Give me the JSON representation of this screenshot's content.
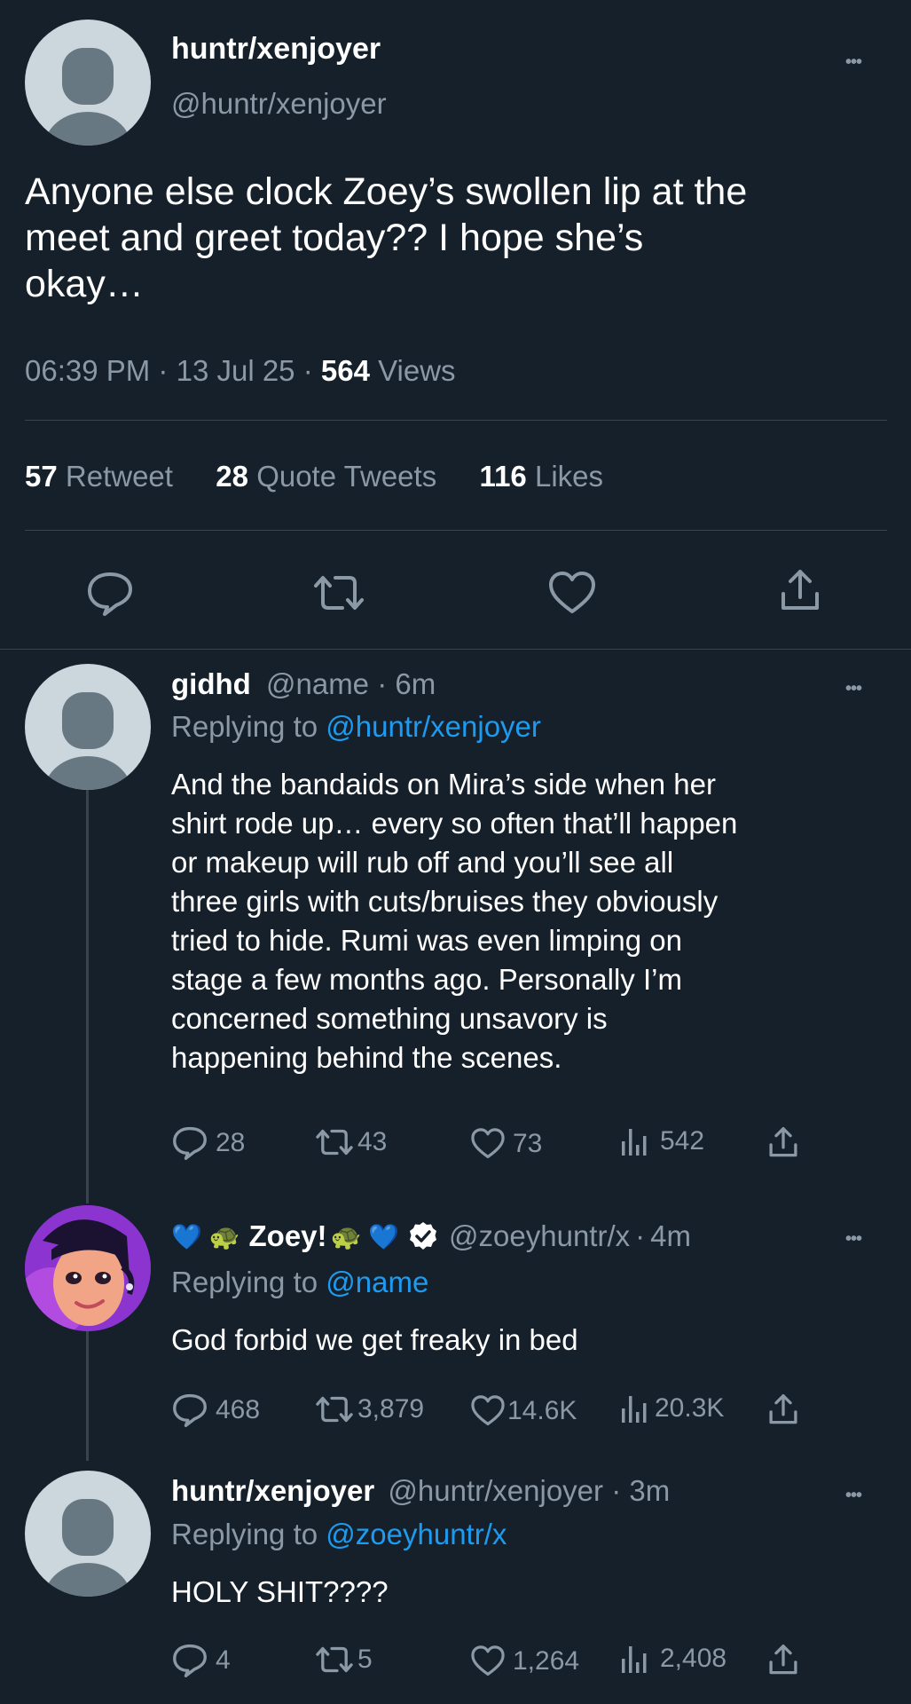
{
  "main_tweet": {
    "display_name": "huntr/xenjoyer",
    "handle": "@huntr/xenjoyer",
    "text_lines": [
      "Anyone else clock Zoey’s swollen lip at the",
      "meet and greet today?? I hope she’s",
      "okay…"
    ],
    "time": "06:39 PM",
    "date": "13 Jul 25",
    "views_count": "564",
    "views_label": "Views",
    "retweets_count": "57",
    "retweets_label": "Retweet",
    "quotes_count": "28",
    "quotes_label": "Quote Tweets",
    "likes_count": "116",
    "likes_label": "Likes",
    "dot": "·"
  },
  "replies": [
    {
      "display_name": "gidhd",
      "handle": "@name",
      "age": "6m",
      "replying_prefix": "Replying to",
      "replying_to": "@huntr/xenjoyer",
      "text_lines": [
        "And the bandaids on Mira’s side when her",
        "shirt rode up… every so often that’ll happen",
        "or makeup will rub off and you’ll see all",
        "three girls with cuts/bruises they obviously",
        "tried to hide. Rumi was even limping on",
        "stage a few months ago. Personally I’m",
        "concerned something unsavory is",
        "happening behind the scenes."
      ],
      "stats": {
        "replies": "28",
        "retweets": "43",
        "likes": "73",
        "views": "542"
      }
    },
    {
      "display_name": "Zoey!",
      "emoji_left": "💙 🐢",
      "emoji_right": "🐢 💙",
      "handle": "@zoeyhuntr/x",
      "age": "4m",
      "replying_prefix": "Replying to",
      "replying_to": "@name",
      "text_lines": [
        "God forbid we get freaky in bed"
      ],
      "stats": {
        "replies": "468",
        "retweets": "3,879",
        "likes": "14.6K",
        "views": "20.3K"
      }
    },
    {
      "display_name": "huntr/xenjoyer",
      "handle": "@huntr/xenjoyer",
      "age": "3m",
      "replying_prefix": "Replying to",
      "replying_to": "@zoeyhuntr/x",
      "text_lines": [
        "HOLY SHIT????"
      ],
      "stats": {
        "replies": "4",
        "retweets": "5",
        "likes": "1,264",
        "views": "2,408"
      }
    }
  ],
  "dot": "·",
  "more_label": "•••",
  "colors": {
    "background": "#15202b",
    "text": "#ffffff",
    "muted": "#8b98a5",
    "accent": "#1d9bf0",
    "divider": "#38444d"
  },
  "icons": [
    "comment-icon",
    "retweet-icon",
    "heart-icon",
    "share-icon",
    "views-icon",
    "verified-badge-icon",
    "more-icon"
  ]
}
